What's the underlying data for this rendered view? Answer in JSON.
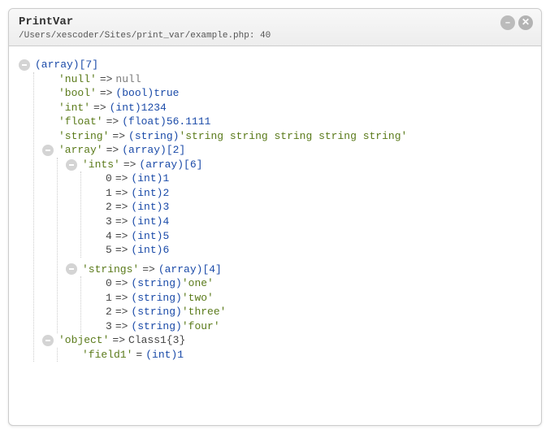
{
  "header": {
    "title": "PrintVar",
    "path": "/Users/xescoder/Sites/print_var/example.php: 40"
  },
  "root": {
    "type_label": "(array)",
    "count": "[7]",
    "items": [
      {
        "key": "'null'",
        "arrow": "=>",
        "type_label": "",
        "value": "null",
        "value_class": "val-null"
      },
      {
        "key": "'bool'",
        "arrow": "=>",
        "type_label": "(bool)",
        "value": "true",
        "value_class": "val-bool"
      },
      {
        "key": "'int'",
        "arrow": "=>",
        "type_label": "(int)",
        "value": "1234",
        "value_class": "type"
      },
      {
        "key": "'float'",
        "arrow": "=>",
        "type_label": "(float)",
        "value": "56.1111",
        "value_class": "type"
      },
      {
        "key": "'string'",
        "arrow": "=>",
        "type_label": "(string)",
        "value": "'string string string string string'",
        "value_class": "val-str"
      }
    ],
    "array_node": {
      "key": "'array'",
      "arrow": "=>",
      "type_label": "(array)",
      "count": "[2]",
      "children": [
        {
          "key": "'ints'",
          "arrow": "=>",
          "type_label": "(array)",
          "count": "[6]",
          "items": [
            {
              "idx": "0",
              "arrow": "=>",
              "type_label": "(int)",
              "value": "1"
            },
            {
              "idx": "1",
              "arrow": "=>",
              "type_label": "(int)",
              "value": "2"
            },
            {
              "idx": "2",
              "arrow": "=>",
              "type_label": "(int)",
              "value": "3"
            },
            {
              "idx": "3",
              "arrow": "=>",
              "type_label": "(int)",
              "value": "4"
            },
            {
              "idx": "4",
              "arrow": "=>",
              "type_label": "(int)",
              "value": "5"
            },
            {
              "idx": "5",
              "arrow": "=>",
              "type_label": "(int)",
              "value": "6"
            }
          ]
        },
        {
          "key": "'strings'",
          "arrow": "=>",
          "type_label": "(array)",
          "count": "[4]",
          "items": [
            {
              "idx": "0",
              "arrow": "=>",
              "type_label": "(string)",
              "value": "'one'"
            },
            {
              "idx": "1",
              "arrow": "=>",
              "type_label": "(string)",
              "value": "'two'"
            },
            {
              "idx": "2",
              "arrow": "=>",
              "type_label": "(string)",
              "value": "'three'"
            },
            {
              "idx": "3",
              "arrow": "=>",
              "type_label": "(string)",
              "value": "'four'"
            }
          ]
        }
      ]
    },
    "object_node": {
      "key": "'object'",
      "arrow": "=>",
      "class_label": "Class1",
      "count": "{3}",
      "items": [
        {
          "key": "'field1'",
          "eq": "=",
          "type_label": "(int)",
          "value": "1"
        }
      ]
    }
  }
}
